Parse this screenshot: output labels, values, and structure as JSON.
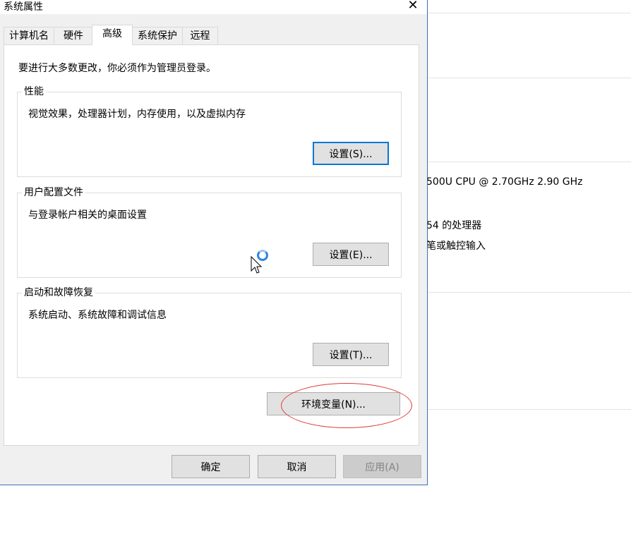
{
  "background": {
    "cpu_text": "500U CPU @ 2.70GHz   2.90 GHz",
    "processor_text": "54 的处理器",
    "touch_text": "笔或触控输入"
  },
  "dialog": {
    "title": "系统属性",
    "close_glyph": "✕",
    "tabs": [
      {
        "label": "计算机名"
      },
      {
        "label": "硬件"
      },
      {
        "label": "高级"
      },
      {
        "label": "系统保护"
      },
      {
        "label": "远程"
      }
    ],
    "active_tab": "高级",
    "intro": "要进行大多数更改，你必须作为管理员登录。",
    "groups": [
      {
        "title": "性能",
        "desc": "视觉效果，处理器计划，内存使用，以及虚拟内存",
        "button": "设置(S)..."
      },
      {
        "title": "用户配置文件",
        "desc": "与登录帐户相关的桌面设置",
        "button": "设置(E)..."
      },
      {
        "title": "启动和故障恢复",
        "desc": "系统启动、系统故障和调试信息",
        "button": "设置(T)..."
      }
    ],
    "env_button": "环境变量(N)...",
    "footer": {
      "ok": "确定",
      "cancel": "取消",
      "apply": "应用(A)"
    }
  },
  "colors": {
    "annotation": "#e23b3b",
    "focus": "#0078d7",
    "busy_cursor": "#2f86e0"
  }
}
